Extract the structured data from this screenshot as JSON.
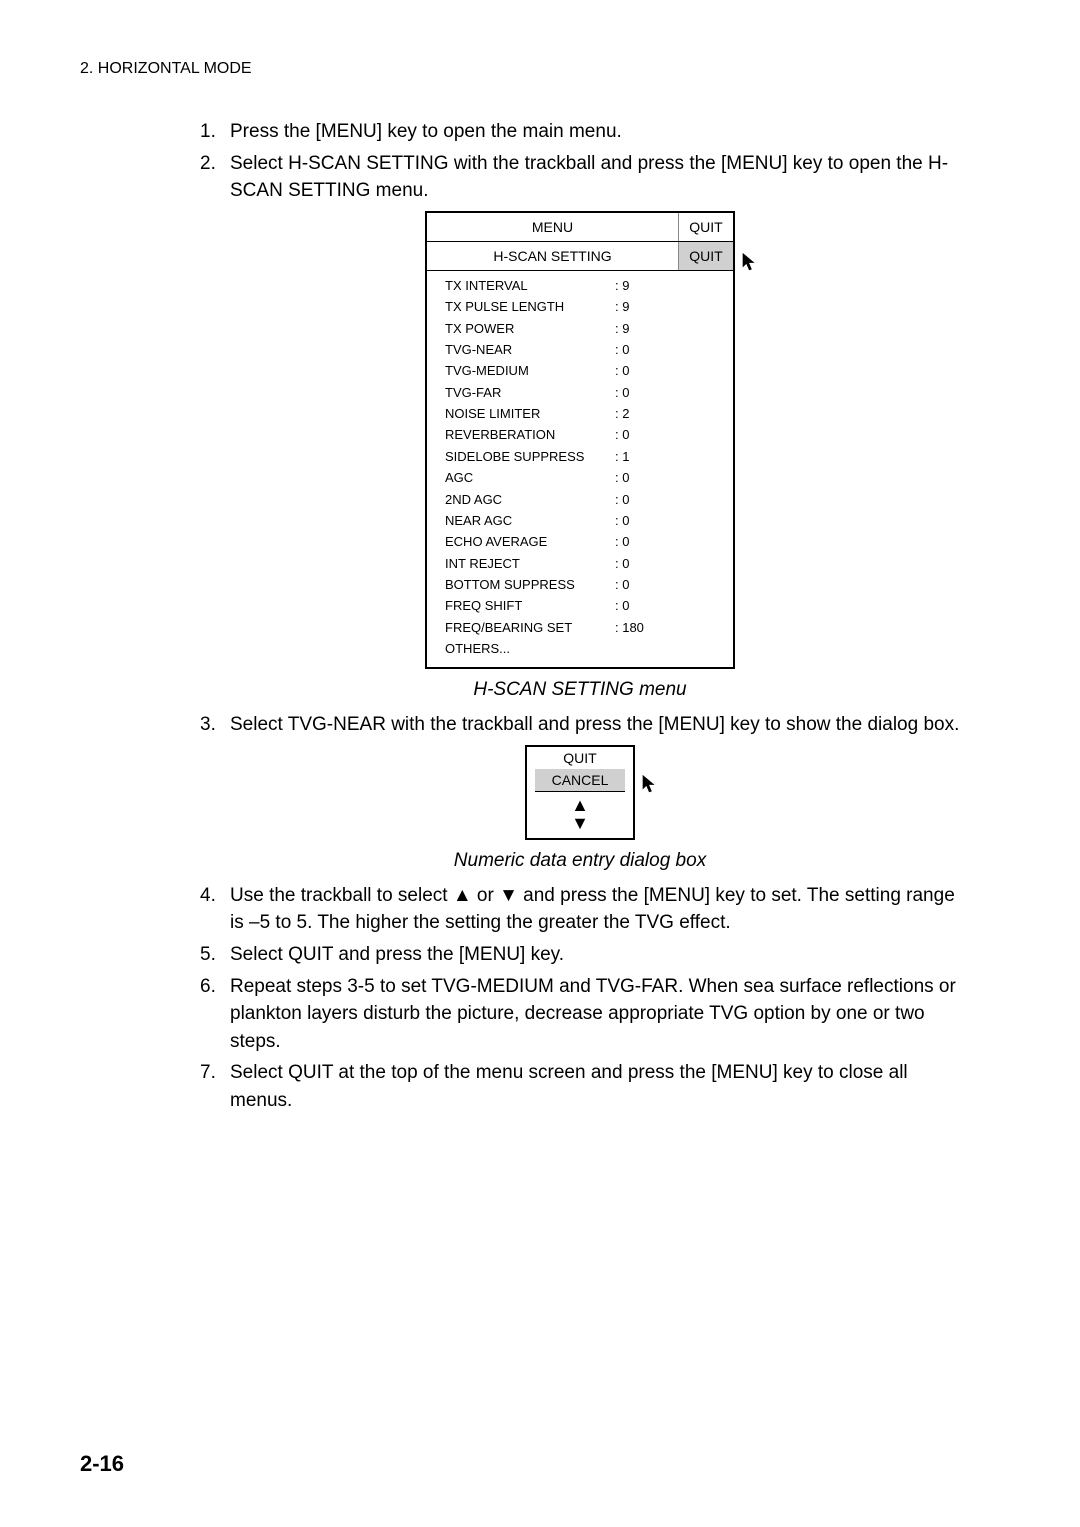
{
  "header": "2. HORIZONTAL MODE",
  "steps": {
    "s1": {
      "num": "1.",
      "text": "Press the [MENU] key to open the main menu."
    },
    "s2": {
      "num": "2.",
      "text": "Select H-SCAN SETTING with the trackball and press the [MENU] key to open the H-SCAN SETTING menu."
    },
    "s3": {
      "num": "3.",
      "text": "Select TVG-NEAR with the trackball and press the [MENU] key to show the dialog box."
    },
    "s4": {
      "num": "4.",
      "text": "Use the trackball to select ▲ or ▼ and press the [MENU] key to set. The setting range is –5 to 5. The higher the setting the greater the TVG effect."
    },
    "s5": {
      "num": "5.",
      "text": "Select QUIT and press the [MENU] key."
    },
    "s6": {
      "num": "6.",
      "text": "Repeat steps 3-5 to set TVG-MEDIUM and TVG-FAR. When sea surface reflections or plankton layers disturb the picture, decrease appropriate TVG option by one or two steps."
    },
    "s7": {
      "num": "7.",
      "text": "Select QUIT at the top of the menu screen and press the [MENU] key to close all menus."
    }
  },
  "menu": {
    "title": "MENU",
    "quit": "QUIT",
    "subtitle": "H-SCAN SETTING",
    "subquit": "QUIT",
    "rows": [
      {
        "label": "TX INTERVAL",
        "val": ": 9"
      },
      {
        "label": "TX PULSE LENGTH",
        "val": ": 9"
      },
      {
        "label": "TX POWER",
        "val": ": 9"
      },
      {
        "label": "TVG-NEAR",
        "val": ": 0"
      },
      {
        "label": "TVG-MEDIUM",
        "val": ": 0"
      },
      {
        "label": "TVG-FAR",
        "val": ": 0"
      },
      {
        "label": "NOISE LIMITER",
        "val": ": 2"
      },
      {
        "label": "REVERBERATION",
        "val": ": 0"
      },
      {
        "label": "SIDELOBE SUPPRESS",
        "val": ": 1"
      },
      {
        "label": "AGC",
        "val": ": 0"
      },
      {
        "label": "2ND AGC",
        "val": ": 0"
      },
      {
        "label": "NEAR AGC",
        "val": ": 0"
      },
      {
        "label": "ECHO AVERAGE",
        "val": ": 0"
      },
      {
        "label": "INT REJECT",
        "val": ": 0"
      },
      {
        "label": "BOTTOM SUPPRESS",
        "val": ": 0"
      },
      {
        "label": "FREQ SHIFT",
        "val": ": 0"
      },
      {
        "label": "FREQ/BEARING SET",
        "val": ": 180"
      },
      {
        "label": "OTHERS...",
        "val": ""
      }
    ]
  },
  "caption1": "H-SCAN SETTING menu",
  "dialog": {
    "quit": "QUIT",
    "cancel": "CANCEL",
    "up": "▲",
    "down": "▼"
  },
  "caption2": "Numeric data entry dialog box",
  "pagenum": "2-16"
}
